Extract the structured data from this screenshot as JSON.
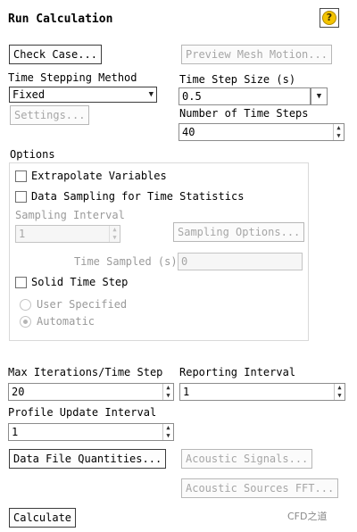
{
  "window": {
    "title": "Run Calculation",
    "help_glyph": "?"
  },
  "buttons": {
    "check_case": "Check Case...",
    "preview_mesh_motion": "Preview Mesh Motion...",
    "settings": "Settings...",
    "sampling_options": "Sampling Options...",
    "data_file_quantities": "Data File Quantities...",
    "acoustic_signals": "Acoustic Signals...",
    "acoustic_sources_fft": "Acoustic Sources FFT...",
    "calculate": "Calculate"
  },
  "time_stepping_method": {
    "label": "Time Stepping Method",
    "value": "Fixed"
  },
  "time_step_size": {
    "label": "Time Step Size (s)",
    "value": "0.5"
  },
  "number_of_time_steps": {
    "label": "Number of Time Steps",
    "value": "40"
  },
  "options": {
    "label": "Options",
    "extrapolate_variables": {
      "label": "Extrapolate Variables",
      "checked": false
    },
    "data_sampling": {
      "label": "Data Sampling for Time Statistics",
      "checked": false
    },
    "sampling_interval": {
      "label": "Sampling Interval",
      "value": "1"
    },
    "time_sampled": {
      "label": "Time Sampled (s)",
      "value": "0"
    },
    "solid_time_step": {
      "label": "Solid Time Step",
      "checked": false
    },
    "user_specified": {
      "label": "User Specified",
      "selected": false
    },
    "automatic": {
      "label": "Automatic",
      "selected": true
    }
  },
  "max_iterations": {
    "label": "Max Iterations/Time Step",
    "value": "20"
  },
  "reporting_interval": {
    "label": "Reporting Interval",
    "value": "1"
  },
  "profile_update_interval": {
    "label": "Profile Update Interval",
    "value": "1"
  },
  "watermark": {
    "text": "CFD之道"
  },
  "icons": {
    "help": "help-icon",
    "spin_up": "▲",
    "spin_down": "▼",
    "dropdown": "▼"
  },
  "colors": {
    "help_icon_fill": "#f4c400",
    "disabled_text": "#a6a6a6"
  }
}
